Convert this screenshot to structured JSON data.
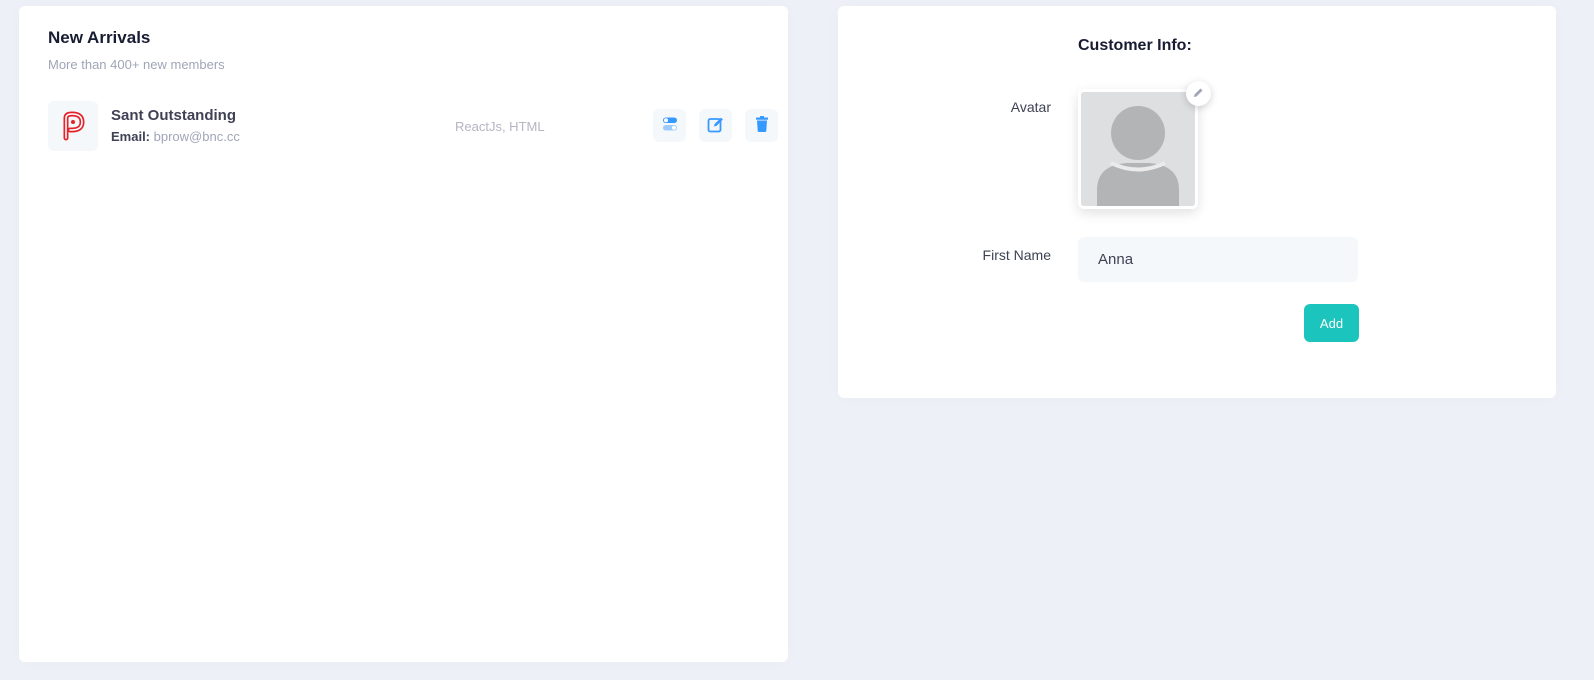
{
  "new_arrivals": {
    "title": "New Arrivals",
    "subtitle": "More than 400+ new members",
    "members": [
      {
        "name": "Sant Outstanding",
        "email_label": "Email:",
        "email": "bprow@bnc.cc",
        "skills": "ReactJs, HTML",
        "logo_icon": "brand-p-logo-icon"
      }
    ],
    "actions": [
      "toggle-icon",
      "edit-icon",
      "trash-icon"
    ]
  },
  "customer_info": {
    "title": "Customer Info:",
    "avatar_label": "Avatar",
    "first_name_label": "First Name",
    "first_name_value": "Anna",
    "add_button": "Add"
  },
  "colors": {
    "background": "#eef0f8",
    "primary": "#3699ff",
    "success": "#1bc5bd",
    "brand_logo": "#e4222b"
  }
}
